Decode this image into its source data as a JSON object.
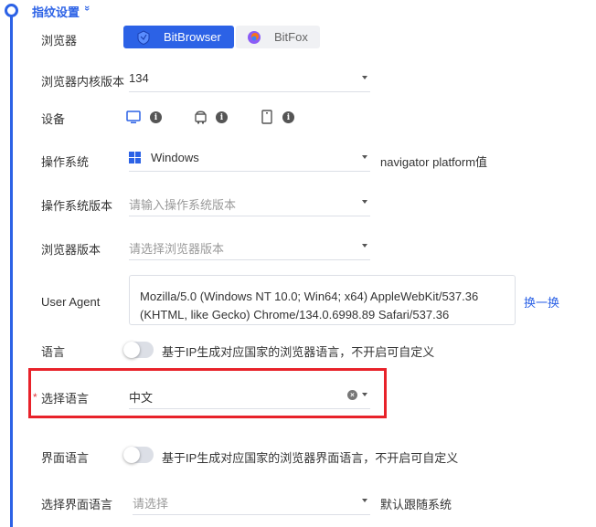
{
  "section": {
    "title": "指纹设置",
    "chevron": "»"
  },
  "browser": {
    "label": "浏览器",
    "options": [
      {
        "name": "BitBrowser",
        "selected": true
      },
      {
        "name": "BitFox",
        "selected": false
      }
    ]
  },
  "kernel": {
    "label": "浏览器内核版本",
    "value": "134"
  },
  "device": {
    "label": "设备",
    "items": [
      {
        "icon": "desktop-icon",
        "selected": true
      },
      {
        "icon": "android-icon",
        "selected": false
      },
      {
        "icon": "mobile-icon",
        "selected": false
      }
    ],
    "info": "i"
  },
  "os": {
    "label": "操作系统",
    "value": "Windows",
    "note": "navigator platform值"
  },
  "os_version": {
    "label": "操作系统版本",
    "placeholder": "请输入操作系统版本"
  },
  "browser_version": {
    "label": "浏览器版本",
    "placeholder": "请选择浏览器版本"
  },
  "user_agent": {
    "label": "User Agent",
    "line1": "Mozilla/5.0 (Windows NT 10.0; Win64; x64) AppleWebKit/537.36",
    "line2": "(KHTML, like Gecko) Chrome/134.0.6998.89 Safari/537.36",
    "action": "换一换"
  },
  "language": {
    "label": "语言",
    "toggle_on": false,
    "toggle_text": "基于IP生成对应国家的浏览器语言，不开启可自定义"
  },
  "select_language": {
    "label": "选择语言",
    "required": "*",
    "value": "中文",
    "clear": "×"
  },
  "ui_language": {
    "label": "界面语言",
    "toggle_on": false,
    "toggle_text": "基于IP生成对应国家的浏览器界面语言，不开启可自定义"
  },
  "select_ui_language": {
    "label": "选择界面语言",
    "placeholder": "请选择",
    "note": "默认跟随系统"
  },
  "colors": {
    "accent": "#2c62e6",
    "highlight": "#e8222a",
    "required": "#e0393e"
  }
}
